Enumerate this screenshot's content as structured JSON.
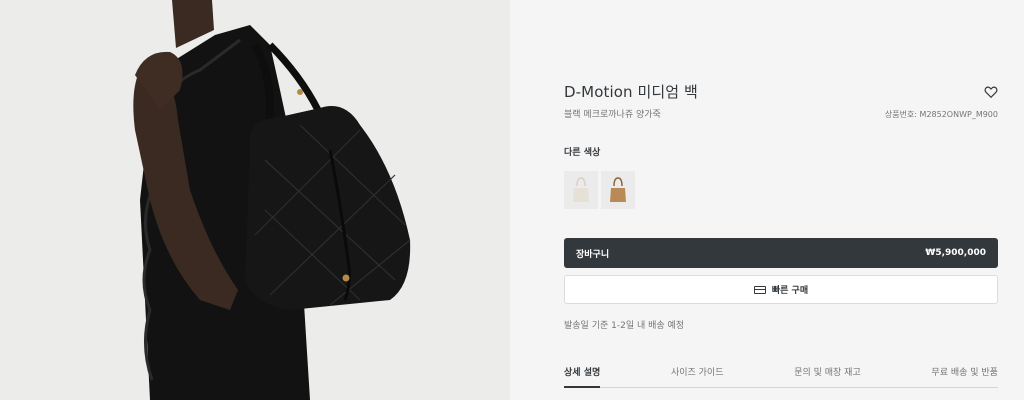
{
  "product": {
    "title": "D-Motion 미디엄 백",
    "subtitle": "블랙 메크로까나쥬 양가죽",
    "reference": "상품번호: M2852ONWP_M900"
  },
  "colors": {
    "label": "다른 색상",
    "options": [
      {
        "name": "latte-swatch",
        "color": "#e6e0d6"
      },
      {
        "name": "tan-swatch",
        "color": "#b98a55"
      }
    ]
  },
  "cart": {
    "label": "장바구니",
    "price": "₩5,900,000"
  },
  "quick_buy": {
    "label": "빠른 구매"
  },
  "delivery": {
    "text": "발송일 기준 1-2일 내 배송 예정"
  },
  "tabs": [
    {
      "label": "상세 설명"
    },
    {
      "label": "사이즈 가이드"
    },
    {
      "label": "문의 및 매장 재고"
    },
    {
      "label": "무료 배송 및 반품"
    }
  ],
  "theme": {
    "dark": "#33383c",
    "panel_bg": "#f5f5f5"
  }
}
